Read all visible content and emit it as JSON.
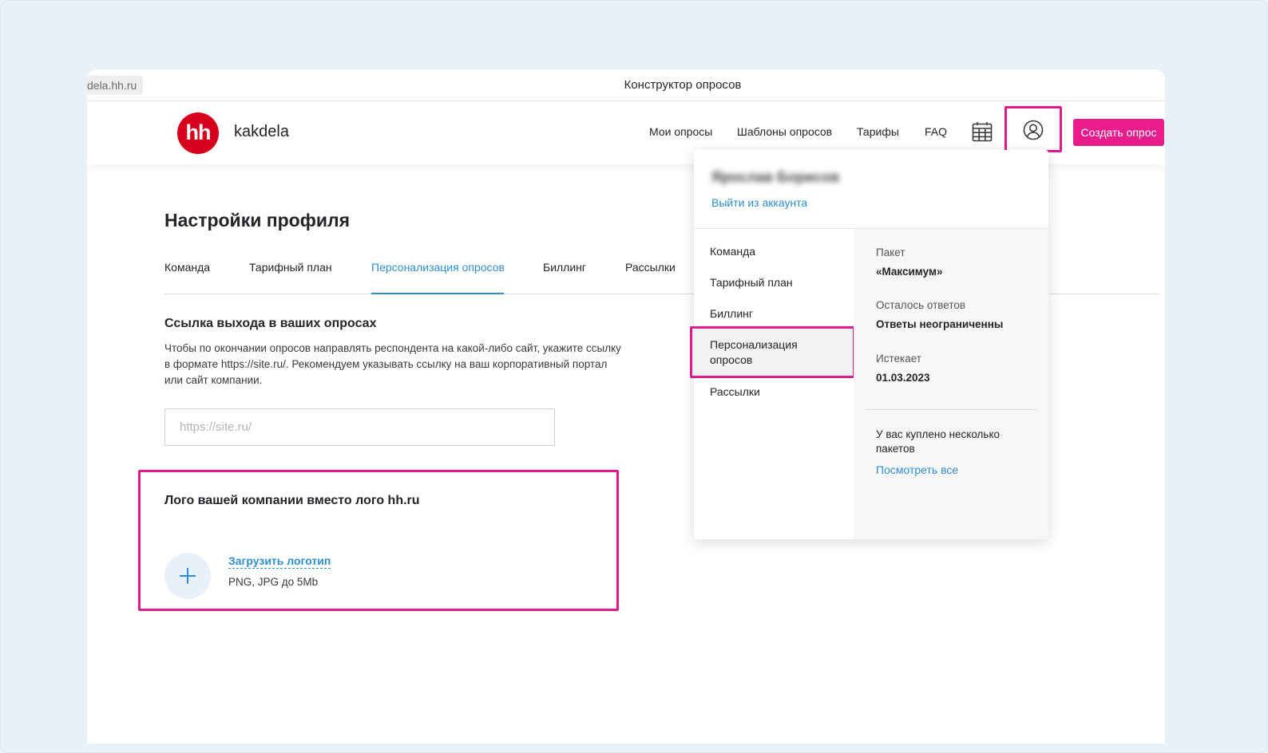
{
  "browser": {
    "url": "dela.hh.ru",
    "window_title": "Конструктор опросов"
  },
  "header": {
    "logo_text": "hh",
    "brand": "kakdela",
    "nav": [
      "Мои опросы",
      "Шаблоны опросов",
      "Тарифы",
      "FAQ"
    ],
    "create_button": "Создать опрос"
  },
  "page": {
    "title": "Настройки профиля",
    "tabs": [
      "Команда",
      "Тарифный план",
      "Персонализация опросов",
      "Биллинг",
      "Рассылки"
    ],
    "active_tab": "Персонализация опросов"
  },
  "exit_link_section": {
    "title": "Ссылка выхода в ваших опросах",
    "description_lines": [
      "Чтобы по окончании опросов направлять респондента на какой-либо сайт, укажите ссылку",
      "в формате https://site.ru/. Рекомендуем указывать ссылку на ваш корпоративный портал",
      "или сайт компании."
    ],
    "input_value": "",
    "input_placeholder": "https://site.ru/"
  },
  "logo_section": {
    "title": "Лого вашей компании вместо лого hh.ru",
    "upload_link": "Загрузить логотип",
    "hint": "PNG, JPG до 5Mb"
  },
  "profile_menu": {
    "user_name": "Ярослав Борисов",
    "logout": "Выйти из аккаунта",
    "items": [
      "Команда",
      "Тарифный план",
      "Биллинг",
      "Персонализация опросов",
      "Рассылки"
    ],
    "highlighted_item": "Персонализация опросов",
    "package_label": "Пакет",
    "package_value": "«Максимум»",
    "answers_label": "Осталось ответов",
    "answers_value": "Ответы неограниченны",
    "expires_label": "Истекает",
    "expires_value": "01.03.2023",
    "note": "У вас куплено несколько пакетов",
    "view_all": "Посмотреть все"
  },
  "colors": {
    "brand_red": "#d6001c",
    "accent_pink": "#ea1c8b",
    "highlight_border": "#e01c8d",
    "link_blue": "#2d8ed5"
  },
  "icons": [
    "calendar-icon",
    "user-profile-icon",
    "plus-icon"
  ]
}
